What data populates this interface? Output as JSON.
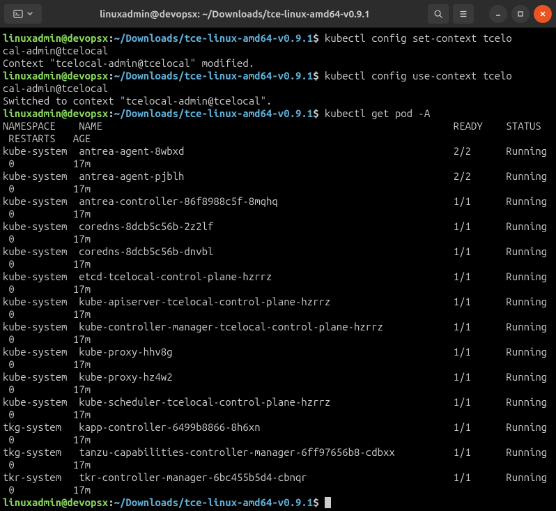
{
  "titlebar": {
    "title": "linuxadmin@devopsx: ~/Downloads/tce-linux-amd64-v0.9.1"
  },
  "prompt": {
    "user_host": "linuxadmin@devopsx",
    "path": "~/Downloads/tce-linux-amd64-v0.9.1",
    "symbol": "$"
  },
  "commands": {
    "cmd1": "kubectl config set-context tcelocal-admin@tcelocal",
    "out1": "Context \"tcelocal-admin@tcelocal\" modified.",
    "cmd2": "kubectl config use-context tcelocal-admin@tcelocal",
    "out2": "Switched to context \"tcelocal-admin@tcelocal\".",
    "cmd3": "kubectl get pod -A"
  },
  "header": {
    "namespace": "NAMESPACE",
    "name": "NAME",
    "ready": "READY",
    "status": "STATUS",
    "restarts": "RESTARTS",
    "age": "AGE"
  },
  "pods": [
    {
      "ns": "kube-system",
      "name": "antrea-agent-8wbxd",
      "ready": "2/2",
      "status": "Running",
      "restarts": "0",
      "age": "17m"
    },
    {
      "ns": "kube-system",
      "name": "antrea-agent-pjblh",
      "ready": "2/2",
      "status": "Running",
      "restarts": "0",
      "age": "17m"
    },
    {
      "ns": "kube-system",
      "name": "antrea-controller-86f8988c5f-8mqhq",
      "ready": "1/1",
      "status": "Running",
      "restarts": "0",
      "age": "17m"
    },
    {
      "ns": "kube-system",
      "name": "coredns-8dcb5c56b-2z2lf",
      "ready": "1/1",
      "status": "Running",
      "restarts": "0",
      "age": "17m"
    },
    {
      "ns": "kube-system",
      "name": "coredns-8dcb5c56b-dnvbl",
      "ready": "1/1",
      "status": "Running",
      "restarts": "0",
      "age": "17m"
    },
    {
      "ns": "kube-system",
      "name": "etcd-tcelocal-control-plane-hzrrz",
      "ready": "1/1",
      "status": "Running",
      "restarts": "0",
      "age": "17m"
    },
    {
      "ns": "kube-system",
      "name": "kube-apiserver-tcelocal-control-plane-hzrrz",
      "ready": "1/1",
      "status": "Running",
      "restarts": "0",
      "age": "17m"
    },
    {
      "ns": "kube-system",
      "name": "kube-controller-manager-tcelocal-control-plane-hzrrz",
      "ready": "1/1",
      "status": "Running",
      "restarts": "0",
      "age": "17m"
    },
    {
      "ns": "kube-system",
      "name": "kube-proxy-hhv8g",
      "ready": "1/1",
      "status": "Running",
      "restarts": "0",
      "age": "17m"
    },
    {
      "ns": "kube-system",
      "name": "kube-proxy-hz4w2",
      "ready": "1/1",
      "status": "Running",
      "restarts": "0",
      "age": "17m"
    },
    {
      "ns": "kube-system",
      "name": "kube-scheduler-tcelocal-control-plane-hzrrz",
      "ready": "1/1",
      "status": "Running",
      "restarts": "0",
      "age": "17m"
    },
    {
      "ns": "tkg-system",
      "name": "kapp-controller-6499b8866-8h6xn",
      "ready": "1/1",
      "status": "Running",
      "restarts": "0",
      "age": "17m"
    },
    {
      "ns": "tkg-system",
      "name": "tanzu-capabilities-controller-manager-6ff97656b8-cdbxx",
      "ready": "1/1",
      "status": "Running",
      "restarts": "0",
      "age": "17m"
    },
    {
      "ns": "tkr-system",
      "name": "tkr-controller-manager-6bc455b5d4-cbnqr",
      "ready": "1/1",
      "status": "Running",
      "restarts": "0",
      "age": "17m"
    }
  ]
}
